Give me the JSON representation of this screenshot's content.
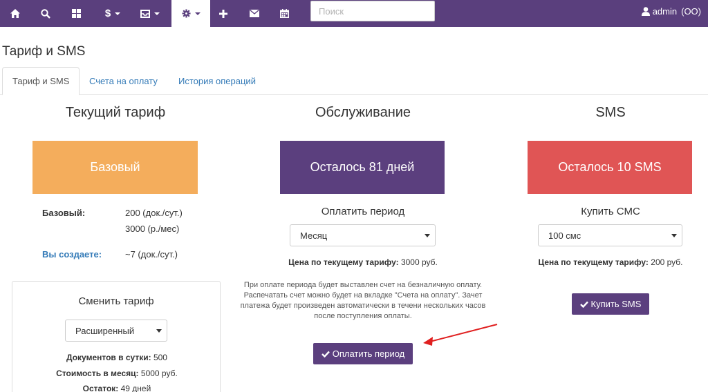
{
  "navbar": {
    "search_placeholder": "Поиск",
    "user_name": "admin",
    "user_org": "(ОО)",
    "icons": [
      "home-icon",
      "search-icon",
      "grid-icon",
      "dollar-icon",
      "inbox-icon",
      "gear-icon",
      "plus-icon",
      "envelope-icon",
      "calendar-icon",
      "user-icon"
    ]
  },
  "page": {
    "title": "Тариф и SMS"
  },
  "tabs": [
    {
      "label": "Тариф и SMS",
      "active": true
    },
    {
      "label": "Счета на оплату",
      "active": false
    },
    {
      "label": "История операций",
      "active": false
    }
  ],
  "tariff": {
    "heading": "Текущий тариф",
    "banner": "Базовый",
    "plan_label": "Базовый:",
    "plan_docs": "200 (док./сут.)",
    "plan_price": "3000 (р./мес)",
    "usage_label": "Вы создаете:",
    "usage_value": "~7 (док./сут.)"
  },
  "change": {
    "heading": "Сменить тариф",
    "selected": "Расширенный",
    "docs_label": "Документов в сутки:",
    "docs_value": "500",
    "cost_label": "Стоимость в месяц:",
    "cost_value": "5000 руб.",
    "rest_label": "Остаток:",
    "rest_value": "49 дней"
  },
  "service": {
    "heading": "Обслуживание",
    "banner": "Осталось 81 дней",
    "pay_heading": "Оплатить период",
    "period_selected": "Месяц",
    "price_label": "Цена по текущему тарифу:",
    "price_value": "3000 руб.",
    "note_lines": [
      "При оплате периода будет выставлен счет на безналичную оплату.",
      "Распечатать счет можно будет на вкладке \"Счета на оплату\". Зачет",
      "платежа будет произведен автоматически в течени нескольких часов",
      "после поступления оплаты."
    ],
    "pay_button": "Оплатить период"
  },
  "sms": {
    "heading": "SMS",
    "banner": "Осталось 10 SMS",
    "buy_heading": "Купить СМС",
    "amount_selected": "100 смс",
    "price_label": "Цена по текущему тарифу:",
    "price_value": "200 руб.",
    "buy_button": "Купить SMS"
  },
  "colors": {
    "navbar": "#5a3f7d",
    "tariff_banner": "#f4ad5c",
    "service_banner": "#5b3f7e",
    "sms_banner": "#e05555",
    "button": "#5b3f7e",
    "link": "#337ab7",
    "annotation_arrow": "#e02020"
  }
}
